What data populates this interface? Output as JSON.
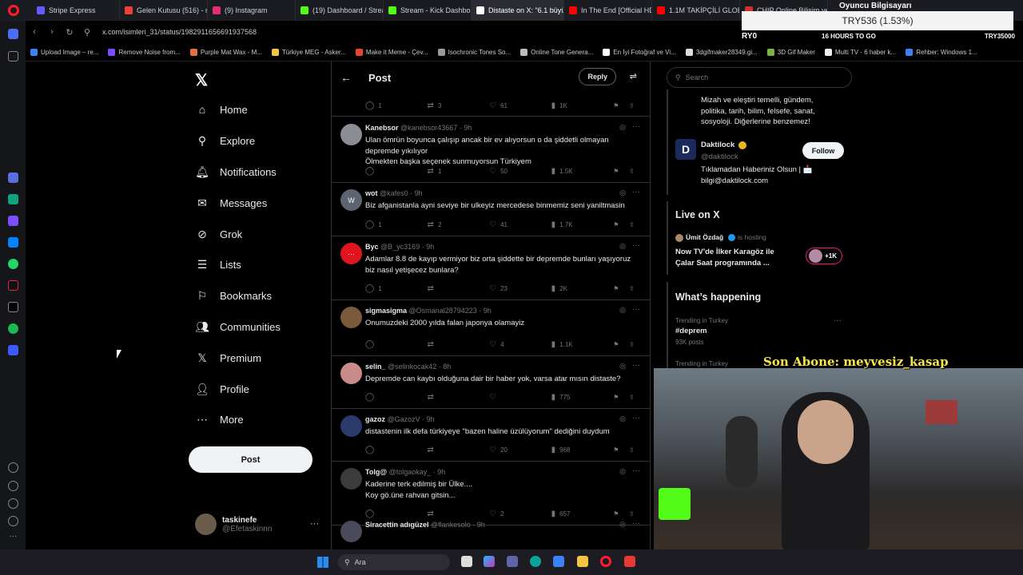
{
  "tabs": [
    {
      "label": "Stripe Express",
      "color": "#635bff"
    },
    {
      "label": "Gelen Kutusu (516) - no...",
      "color": "#ea4335"
    },
    {
      "label": "(9) Instagram",
      "color": "#e1306c"
    },
    {
      "label": "(19) Dashboard / Stream",
      "color": "#53fc18"
    },
    {
      "label": "Stream - Kick Dashboard",
      "color": "#53fc18"
    },
    {
      "label": "Distaste on X: \"6.1 büyükl...",
      "color": "#ffffff"
    },
    {
      "label": "In The End [Official HD M...",
      "color": "#ff0000"
    },
    {
      "label": "1.1M TAKİPÇİLİ GLOBAL...",
      "color": "#ff0000"
    },
    {
      "label": "CHIP Online Bilişim ve T...",
      "color": "#d32f2f"
    },
    {
      "label": "Oyuncu Bilgisayarı",
      "color": "#d32f2f"
    }
  ],
  "address": {
    "url": "x.com/isimleri_31/status/1982911656691937568"
  },
  "bookmarks": [
    "Upload Image – re...",
    "Remove Noise from...",
    "Purple Mat Wax - M...",
    "Türkiye MEG - Asker...",
    "Make it Meme - Çev...",
    "Isochronic Tones So...",
    "Online Tone Genera...",
    "En İyi Fotoğraf ve Vi...",
    "3dgifmaker28349.gi...",
    "3D Gif Maker",
    "Multi TV - 6 haber k...",
    "Rehber: Windows 1..."
  ],
  "nav": {
    "logo": "𝕏",
    "items": [
      "Home",
      "Explore",
      "Notifications",
      "Messages",
      "Grok",
      "Lists",
      "Bookmarks",
      "Communities",
      "Premium",
      "Profile",
      "More"
    ],
    "post": "Post",
    "account_name": "taskinefe",
    "account_handle": "@Efetaskinnn"
  },
  "header": {
    "title": "Post",
    "reply": "Reply"
  },
  "top_actions": {
    "replies": "1",
    "reposts": "3",
    "likes": "61",
    "views": "1K"
  },
  "tweets": [
    {
      "name": "Kanebsor",
      "handle": "@kanebsor43667 · 9h",
      "text": "Ulan ömrün boyunca çalışıp ancak bir ev alıyorsun o da şiddetli olmayan depremde yıkılıyor\nÖlmekten başka seçenek sunmuyorsun Türkiyem",
      "replies": "",
      "reposts": "1",
      "likes": "50",
      "views": "1.5K",
      "avatar": "#8a8d91"
    },
    {
      "name": "wot",
      "handle": "@kafes0 · 9h",
      "text": "Biz afganistanla ayni seviye bir ulkeyiz mercedese binmemiz seni yaniltmasin",
      "replies": "1",
      "reposts": "2",
      "likes": "41",
      "views": "1.7K",
      "avatar": "#5b6470",
      "initial": "W"
    },
    {
      "name": "Byc",
      "handle": "@B_yc3169 · 9h",
      "text": "Adamlar 8.8 de kayıp vermiyor biz orta şiddette bir depremde bunları yaşıyoruz biz nasıl yetişecez bunlara?",
      "replies": "1",
      "reposts": "",
      "likes": "23",
      "views": "2K",
      "avatar": "#e0141e",
      "initial": "···"
    },
    {
      "name": "sigmasigma",
      "handle": "@Osmanal28794223 · 9h",
      "text": "Onumuzdeki 2000 yılda falan japonya olamayiz",
      "replies": "",
      "reposts": "",
      "likes": "4",
      "views": "1.1K",
      "avatar": "#7a5a3a"
    },
    {
      "name": "selin_",
      "handle": "@selinkocak42 · 8h",
      "text": "Depremde can kaybı olduğuna dair bir haber yok, varsa atar mısın distaste?",
      "replies": "",
      "reposts": "",
      "likes": "",
      "views": "775",
      "avatar": "#c98a8a"
    },
    {
      "name": "gazoz",
      "handle": "@GazozV · 9h",
      "text": "distastenin ilk defa türkiyeye \"bazen haline üzülüyorum\" dediğini duydum",
      "replies": "",
      "reposts": "",
      "likes": "20",
      "views": "968",
      "avatar": "#2a3a6a"
    },
    {
      "name": "Tolg@",
      "handle": "@tolgaokay_ · 9h",
      "text": "Kaderine terk edilmiş bir Ülke....\nKoy gö.üne rahvan gitsin...",
      "replies": "",
      "reposts": "",
      "likes": "2",
      "views": "657",
      "avatar": "#3b3b3b"
    },
    {
      "name": "Siracettin adıgüzel",
      "handle": "@flankesolo · 9h",
      "text": "",
      "replies": "",
      "reposts": "",
      "likes": "",
      "views": "",
      "avatar": "#4a4a5a"
    }
  ],
  "right": {
    "search_placeholder": "Search",
    "bio_text": "Mizah ve eleştiri temelli, gündem, politika, tarih, bilim, felsefe, sanat, sosyoloji. Diğerlerine benzemez!",
    "daktilock_name": "Daktilock",
    "daktilock_handle": "@daktilock",
    "daktilock_bio": "Tıklamadan Haberiniz Olsun | 📩 bilgi@daktilock.com",
    "follow": "Follow",
    "live_title": "Live on X",
    "live_host": "Ümit Özdağ",
    "live_hosting": "is hosting",
    "live_show": "Now TV'de İlker Karagöz ile Çalar Saat programında ...",
    "live_count": "+1K",
    "happening_title": "What’s happening",
    "trend_meta": "Trending in Turkey",
    "trend_tag": "#deprem",
    "trend_posts": "93K posts",
    "trend_meta2": "Trending in Turkey"
  },
  "overlay": {
    "ticker": "TRY536 (1.53%)",
    "ticker_sub": "16 HOURS TO GO",
    "ticker_left": "RY0",
    "ticker_right": "TRY35000",
    "sub_label": "Son Abone: meyvesiz_kasap"
  },
  "taskbar": {
    "search": "Ara"
  }
}
